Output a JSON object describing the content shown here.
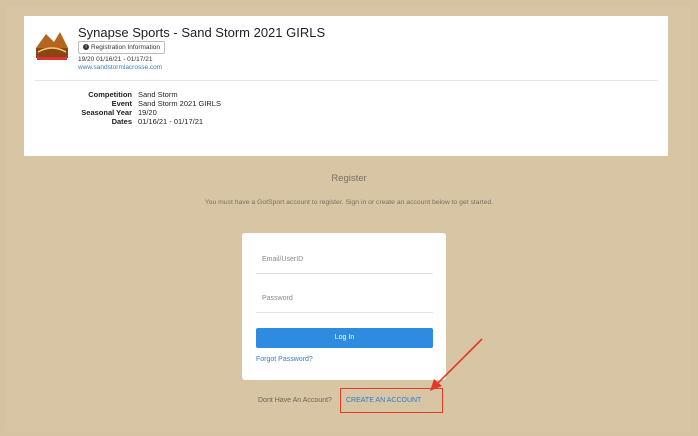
{
  "header": {
    "event_title": "Synapse Sports - Sand Storm 2021 GIRLS",
    "registration_info_label": "Registration Information",
    "dates_line": "19/20 01/16/21 - 01/17/21",
    "website": "www.sandstormlacrosse.com",
    "logo_text": "SAND STORM"
  },
  "info": {
    "rows": [
      {
        "label": "Competition",
        "value": "Sand Storm"
      },
      {
        "label": "Event",
        "value": "Sand Storm 2021 GIRLS"
      },
      {
        "label": "Seasonal Year",
        "value": "19/20"
      },
      {
        "label": "Dates",
        "value": "01/16/21 - 01/17/21"
      }
    ]
  },
  "register": {
    "heading": "Register",
    "subtext": "You must have a GotSport account to register. Sign in or create an account below to get started."
  },
  "login": {
    "email_placeholder": "Email/UserID",
    "password_placeholder": "Password",
    "login_button": "Log In",
    "forgot_password": "Forgot Password?"
  },
  "footer": {
    "no_account_text": "Dont Have An Account?",
    "create_account_link": "CREATE AN ACCOUNT"
  },
  "colors": {
    "background": "#d6c3a1",
    "primary_button": "#2f8be0",
    "link": "#3a7bc8",
    "annotation": "#e23a2a"
  }
}
